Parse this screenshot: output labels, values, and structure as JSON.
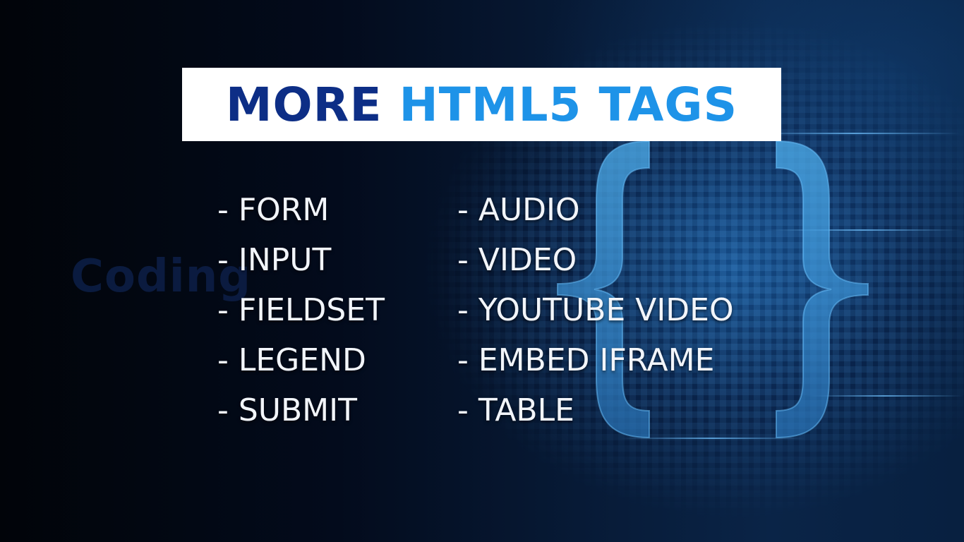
{
  "slide": {
    "title_part1": "MORE",
    "title_part2": "HTML5 TAGS",
    "watermark": "Coding",
    "left_items": [
      "- FORM",
      "- INPUT",
      "- FIELDSET",
      "- LEGEND",
      "- SUBMIT"
    ],
    "right_items": [
      "- AUDIO",
      "- VIDEO",
      "- YOUTUBE VIDEO",
      "- EMBED IFRAME",
      "- TABLE"
    ]
  },
  "colors": {
    "title_dark_blue": "#0d2e86",
    "title_light_blue": "#1e93e8",
    "title_box_bg": "#ffffff",
    "list_text": "#f2f5fa",
    "brace_blue": "#3fa2e6",
    "background": "#020814"
  },
  "icons": [
    "curly-braces-icon"
  ]
}
